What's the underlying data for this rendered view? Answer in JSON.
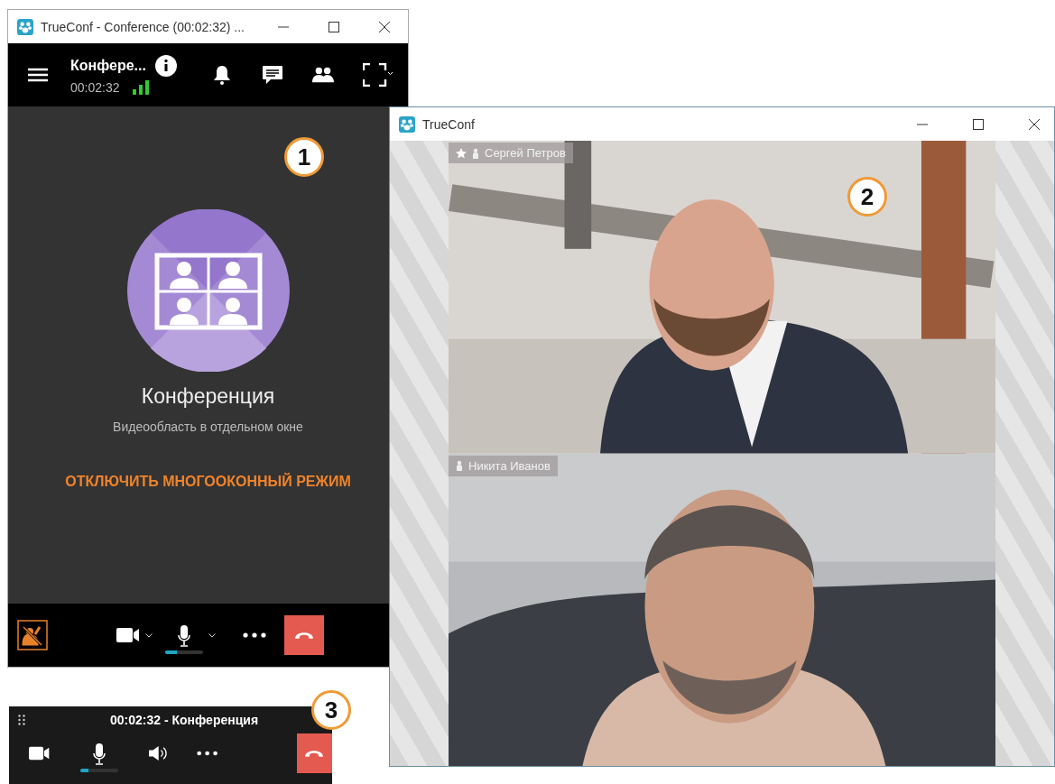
{
  "main_window": {
    "title": "TrueConf - Conference (00:02:32) ...",
    "conference_name": "Конфере...",
    "elapsed": "00:02:32",
    "callout": "1",
    "placeholder_title": "Конференция",
    "placeholder_subtitle": "Видеообласть в отдельном окне",
    "action": "ОТКЛЮЧИТЬ МНОГООКОННЫЙ РЕЖИМ",
    "mic": {
      "level": 0.3
    }
  },
  "video_window": {
    "title": "TrueConf",
    "callout": "2",
    "tiles": [
      {
        "name": "Сергей Петров",
        "moderator": true
      },
      {
        "name": "Никита Иванов",
        "moderator": false
      }
    ]
  },
  "mini_bar": {
    "title": "00:02:32 - Конференция",
    "callout": "3",
    "mic": {
      "level": 0.2
    }
  }
}
